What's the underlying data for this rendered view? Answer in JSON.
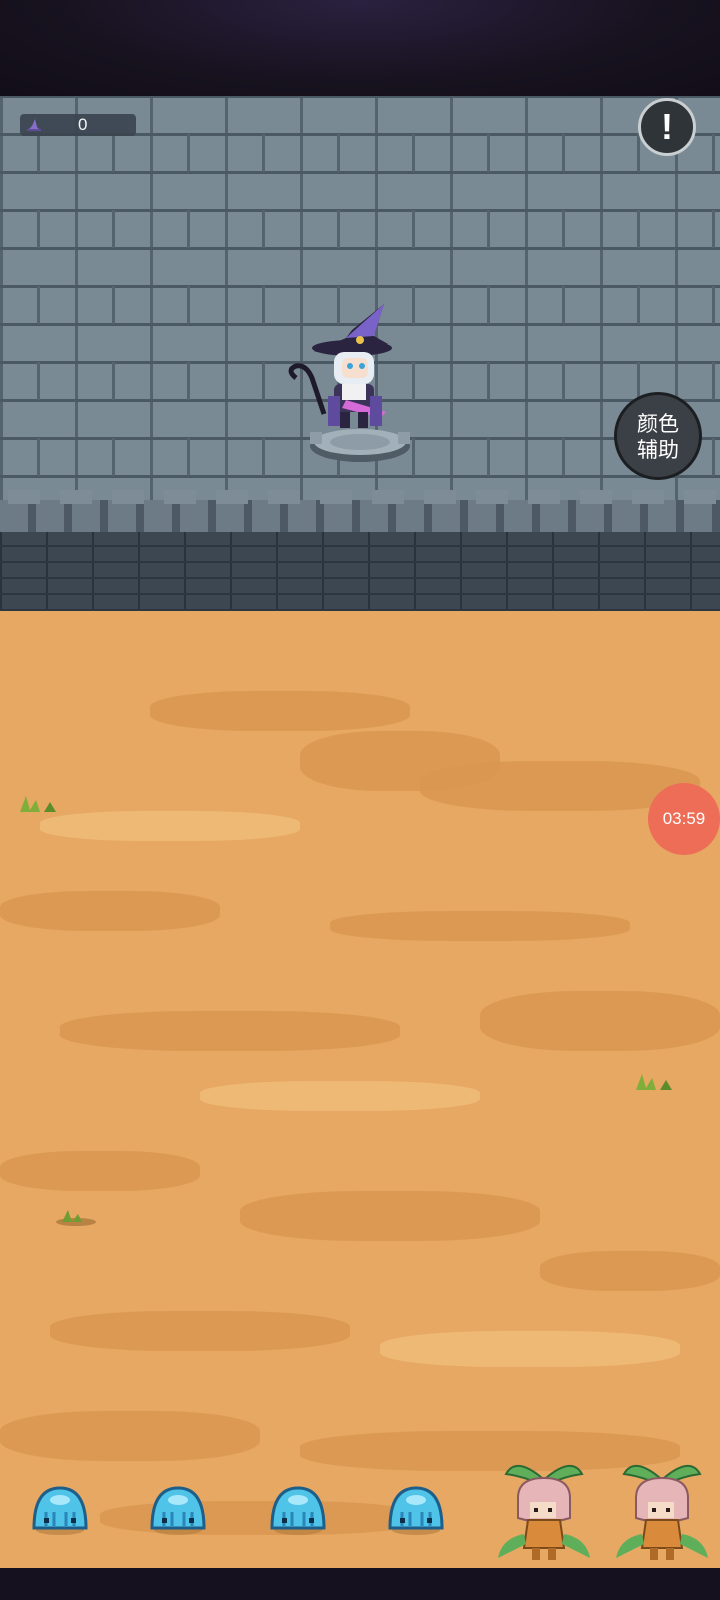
{
  "hud": {
    "score": "0",
    "score_icon": "witch-hat-icon",
    "alert_icon": "exclamation-icon",
    "alert_symbol": "!"
  },
  "color_assist": {
    "line1": "颜色",
    "line2": "辅助"
  },
  "timer": {
    "value": "03:59"
  },
  "enemies": {
    "slimes": [
      {
        "name": "blue-slime"
      },
      {
        "name": "blue-slime"
      },
      {
        "name": "blue-slime"
      },
      {
        "name": "blue-slime"
      }
    ],
    "sprouts": [
      {
        "name": "mandrake-sprout"
      },
      {
        "name": "mandrake-sprout"
      }
    ]
  },
  "colors": {
    "sand": "#e6a862",
    "wall": "#7a8a95",
    "timer_bg": "#ee6d57",
    "slime": "#4fc3e8"
  }
}
